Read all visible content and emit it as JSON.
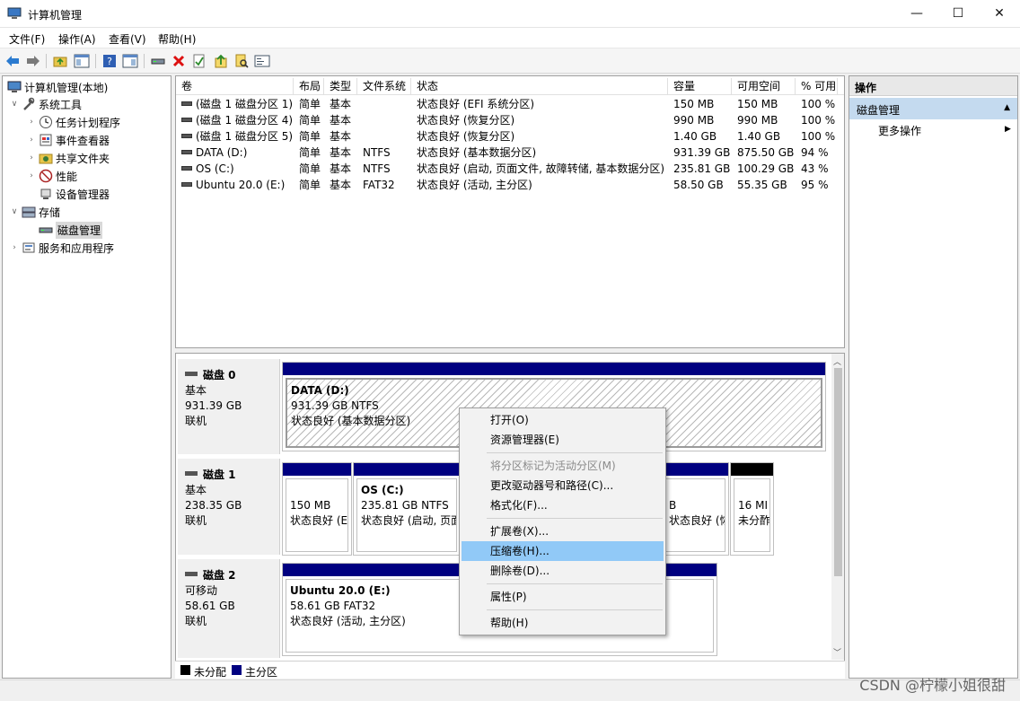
{
  "window": {
    "title": "计算机管理",
    "minimize": "—",
    "maximize": "☐",
    "close": "✕"
  },
  "menu": [
    "文件(F)",
    "操作(A)",
    "查看(V)",
    "帮助(H)"
  ],
  "tree": {
    "root": "计算机管理(本地)",
    "system_tools": "系统工具",
    "task_scheduler": "任务计划程序",
    "event_viewer": "事件查看器",
    "shared_folders": "共享文件夹",
    "performance": "性能",
    "device_manager": "设备管理器",
    "storage": "存储",
    "disk_management": "磁盘管理",
    "services_apps": "服务和应用程序"
  },
  "volume_list": {
    "columns": [
      "卷",
      "布局",
      "类型",
      "文件系统",
      "状态",
      "容量",
      "可用空间",
      "% 可用"
    ],
    "rows": [
      [
        "(磁盘 1 磁盘分区 1)",
        "简单",
        "基本",
        "",
        "状态良好 (EFI 系统分区)",
        "150 MB",
        "150 MB",
        "100 %"
      ],
      [
        "(磁盘 1 磁盘分区 4)",
        "简单",
        "基本",
        "",
        "状态良好 (恢复分区)",
        "990 MB",
        "990 MB",
        "100 %"
      ],
      [
        "(磁盘 1 磁盘分区 5)",
        "简单",
        "基本",
        "",
        "状态良好 (恢复分区)",
        "1.40 GB",
        "1.40 GB",
        "100 %"
      ],
      [
        "DATA (D:)",
        "简单",
        "基本",
        "NTFS",
        "状态良好 (基本数据分区)",
        "931.39 GB",
        "875.50 GB",
        "94 %"
      ],
      [
        "OS (C:)",
        "简单",
        "基本",
        "NTFS",
        "状态良好 (启动, 页面文件, 故障转储, 基本数据分区)",
        "235.81 GB",
        "100.29 GB",
        "43 %"
      ],
      [
        "Ubuntu 20.0 (E:)",
        "简单",
        "基本",
        "FAT32",
        "状态良好 (活动, 主分区)",
        "58.50 GB",
        "55.35 GB",
        "95 %"
      ]
    ]
  },
  "disks": {
    "disk0": {
      "name": "磁盘 0",
      "type": "基本",
      "size": "931.39 GB",
      "status": "联机",
      "p1": {
        "title": "DATA  (D:)",
        "line2": "931.39 GB NTFS",
        "line3": "状态良好 (基本数据分区)"
      }
    },
    "disk1": {
      "name": "磁盘 1",
      "type": "基本",
      "size": "238.35 GB",
      "status": "联机",
      "p1": {
        "line2": "150 MB",
        "line3": "状态良好 (E"
      },
      "p2": {
        "title": "OS  (C:)",
        "line2": "235.81 GB NTFS",
        "line3": "状态良好 (启动, 页面"
      },
      "p3": {
        "line2": "B",
        "line3": "状态良好 (恢复分区"
      },
      "p4": {
        "line2": "16 MI",
        "line3": "未分酢"
      }
    },
    "disk2": {
      "name": "磁盘 2",
      "type": "可移动",
      "size": "58.61 GB",
      "status": "联机",
      "p1": {
        "title": "Ubuntu 20.0  (E:)",
        "line2": "58.61 GB FAT32",
        "line3": "状态良好 (活动, 主分区)"
      }
    }
  },
  "legend": {
    "unallocated": "未分配",
    "primary": "主分区"
  },
  "actions": {
    "header": "操作",
    "section": "磁盘管理",
    "more": "更多操作"
  },
  "context_menu": {
    "open": "打开(O)",
    "explorer": "资源管理器(E)",
    "mark_active": "将分区标记为活动分区(M)",
    "change_letter": "更改驱动器号和路径(C)...",
    "format": "格式化(F)...",
    "extend": "扩展卷(X)...",
    "shrink": "压缩卷(H)...",
    "delete": "删除卷(D)...",
    "properties": "属性(P)",
    "help": "帮助(H)"
  },
  "watermark": "CSDN @柠檬小姐很甜",
  "colors": {
    "primary_partition": "#000080",
    "unallocated": "#000000",
    "menu_highlight": "#91c9f7",
    "action_section": "#c4daef"
  }
}
